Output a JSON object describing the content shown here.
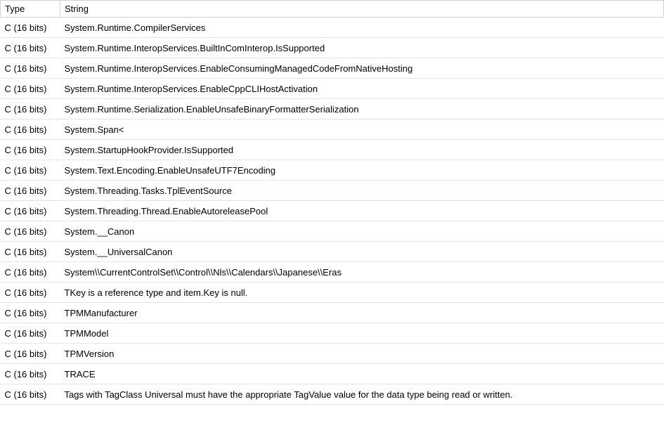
{
  "columns": {
    "type": "Type",
    "string": "String"
  },
  "rows": [
    {
      "type": "C (16 bits)",
      "string": "System.Runtime.CompilerServices"
    },
    {
      "type": "C (16 bits)",
      "string": "System.Runtime.InteropServices.BuiltInComInterop.IsSupported"
    },
    {
      "type": "C (16 bits)",
      "string": "System.Runtime.InteropServices.EnableConsumingManagedCodeFromNativeHosting"
    },
    {
      "type": "C (16 bits)",
      "string": "System.Runtime.InteropServices.EnableCppCLIHostActivation"
    },
    {
      "type": "C (16 bits)",
      "string": "System.Runtime.Serialization.EnableUnsafeBinaryFormatterSerialization"
    },
    {
      "type": "C (16 bits)",
      "string": "System.Span<"
    },
    {
      "type": "C (16 bits)",
      "string": "System.StartupHookProvider.IsSupported"
    },
    {
      "type": "C (16 bits)",
      "string": "System.Text.Encoding.EnableUnsafeUTF7Encoding"
    },
    {
      "type": "C (16 bits)",
      "string": "System.Threading.Tasks.TplEventSource"
    },
    {
      "type": "C (16 bits)",
      "string": "System.Threading.Thread.EnableAutoreleasePool"
    },
    {
      "type": "C (16 bits)",
      "string": "System.__Canon"
    },
    {
      "type": "C (16 bits)",
      "string": "System.__UniversalCanon"
    },
    {
      "type": "C (16 bits)",
      "string": "System\\\\CurrentControlSet\\\\Control\\\\Nls\\\\Calendars\\\\Japanese\\\\Eras"
    },
    {
      "type": "C (16 bits)",
      "string": "TKey is a reference type and item.Key is null."
    },
    {
      "type": "C (16 bits)",
      "string": "TPMManufacturer"
    },
    {
      "type": "C (16 bits)",
      "string": "TPMModel"
    },
    {
      "type": "C (16 bits)",
      "string": "TPMVersion"
    },
    {
      "type": "C (16 bits)",
      "string": "TRACE"
    },
    {
      "type": "C (16 bits)",
      "string": "Tags with TagClass Universal must have the appropriate TagValue value for the data type being read or written."
    }
  ]
}
